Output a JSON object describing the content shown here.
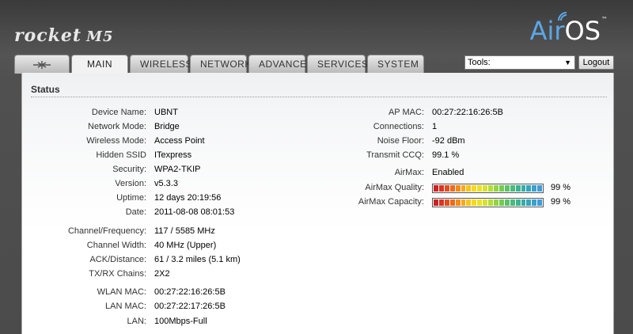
{
  "brand": {
    "product": "rocket",
    "model": "M5",
    "os_air": "Air",
    "os_os": "OS",
    "tm": "™"
  },
  "tabs": [
    {
      "label": ""
    },
    {
      "label": "MAIN"
    },
    {
      "label": "WIRELESS"
    },
    {
      "label": "NETWORK"
    },
    {
      "label": "ADVANCED"
    },
    {
      "label": "SERVICES"
    },
    {
      "label": "SYSTEM"
    }
  ],
  "tools": {
    "selected": "Tools:"
  },
  "logout": {
    "label": "Logout"
  },
  "status": {
    "title": "Status",
    "left": [
      {
        "label": "Device Name:",
        "value": "UBNT"
      },
      {
        "label": "Network Mode:",
        "value": "Bridge"
      },
      {
        "label": "Wireless Mode:",
        "value": "Access Point"
      },
      {
        "label": "Hidden SSID",
        "value": "ITexpress"
      },
      {
        "label": "Security:",
        "value": "WPA2-TKIP"
      },
      {
        "label": "Version:",
        "value": "v5.3.3"
      },
      {
        "label": "Uptime:",
        "value": "12 days 20:19:56"
      },
      {
        "label": "Date:",
        "value": "2011-08-08 08:01:53"
      },
      {
        "label": "Channel/Frequency:",
        "value": "117  /  5585 MHz"
      },
      {
        "label": "Channel Width:",
        "value": "40 MHz  (Upper)"
      },
      {
        "label": "ACK/Distance:",
        "value": "61 / 3.2 miles (5.1 km)"
      },
      {
        "label": "TX/RX Chains:",
        "value": "2X2"
      },
      {
        "label": "WLAN MAC:",
        "value": "00:27:22:16:26:5B"
      },
      {
        "label": "LAN MAC:",
        "value": "00:27:22:17:26:5B"
      },
      {
        "label": "LAN:",
        "value": "100Mbps-Full"
      }
    ],
    "right": [
      {
        "label": "AP MAC:",
        "value": "00:27:22:16:26:5B"
      },
      {
        "label": "Connections:",
        "value": "1"
      },
      {
        "label": "Noise Floor:",
        "value": "-92 dBm"
      },
      {
        "label": "Transmit CCQ:",
        "value": "99.1 %"
      },
      {
        "label": "AirMax:",
        "value": "Enabled"
      }
    ],
    "airmax_quality": {
      "label": "AirMax Quality:",
      "percent": 99,
      "pct_text": "99  %"
    },
    "airmax_capacity": {
      "label": "AirMax Capacity:",
      "percent": 99,
      "pct_text": "99  %"
    }
  },
  "meter_colors": [
    "#cc2222",
    "#dd3322",
    "#e84c1c",
    "#f06a18",
    "#f58a16",
    "#f9a818",
    "#fbc41c",
    "#f7d920",
    "#eae227",
    "#d6e22c",
    "#b6dc34",
    "#93d440",
    "#73cc50",
    "#5ac464",
    "#48bc7a",
    "#3cb490",
    "#36aca6",
    "#34a6bb",
    "#3aa0cc",
    "#3f9cd8"
  ]
}
